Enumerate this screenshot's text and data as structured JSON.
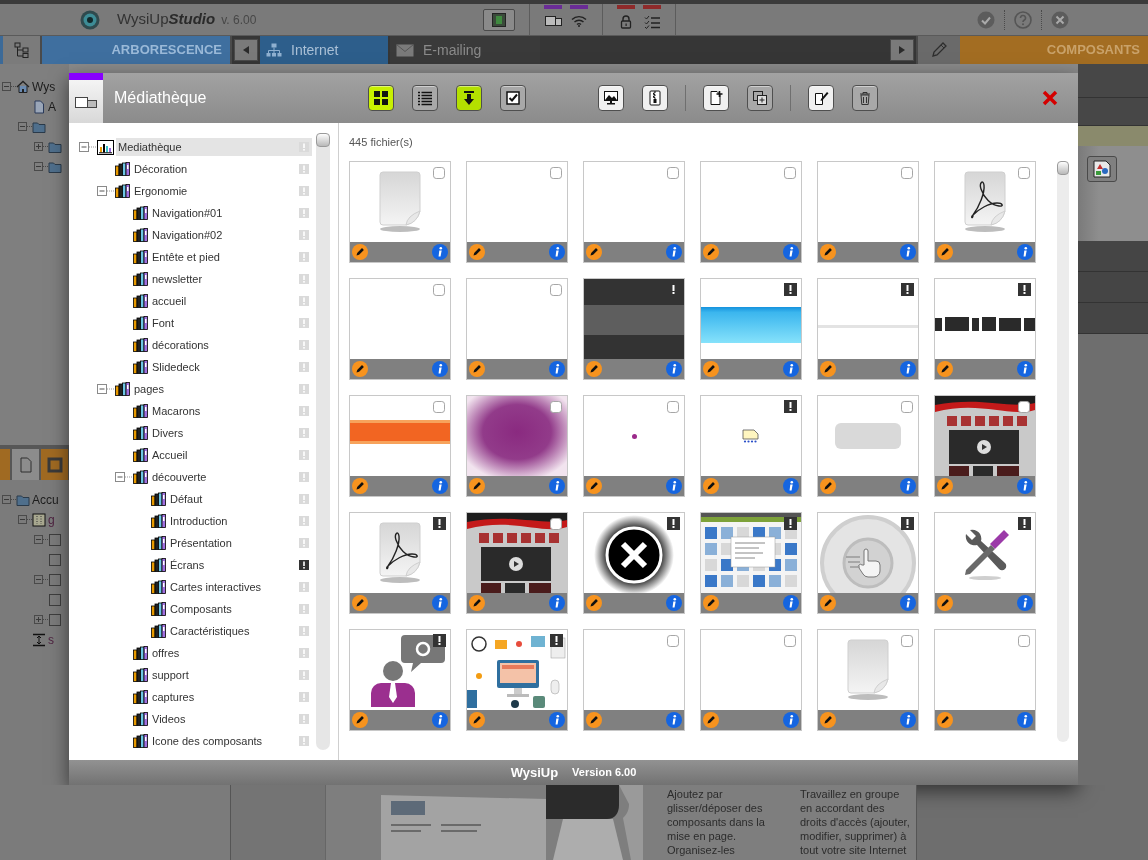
{
  "appbar": {
    "logo": "WysiUp",
    "logo_suffix": "Studio",
    "version": "v. 6.00",
    "tools": [
      {
        "kind": "frame"
      }
    ],
    "indicator_groups": [
      {
        "items": [
          {
            "kind": "windows",
            "color": "#6a2c96"
          },
          {
            "kind": "wifi",
            "color": "#6a2c96"
          }
        ]
      },
      {
        "items": [
          {
            "kind": "lock",
            "color": "#8e2a2a"
          },
          {
            "kind": "checklist",
            "color": "#8e2a2a"
          }
        ]
      }
    ],
    "actions": [
      {
        "kind": "confirm"
      },
      {
        "kind": "help"
      },
      {
        "kind": "close"
      }
    ]
  },
  "panels": {
    "left_title": "ARBORESCENCE",
    "tabs": [
      {
        "label": "Internet",
        "kind": "sitemap",
        "selected": true
      },
      {
        "label": "E-mailing",
        "kind": "mail",
        "selected": false
      }
    ],
    "right_title": "COMPOSANTS"
  },
  "site_tree": {
    "items": [
      {
        "kind": "home",
        "label": "Wys",
        "expanded": true,
        "children": [
          {
            "kind": "page",
            "label": "A"
          },
          {
            "kind": "folder",
            "expanded": true,
            "children": [
              {
                "kind": "folder",
                "expanded": false
              },
              {
                "kind": "folder",
                "expanded": true
              }
            ]
          }
        ]
      }
    ]
  },
  "side_tabs": [
    {
      "kind": "blank",
      "selected": false
    },
    {
      "kind": "page",
      "selected": true
    },
    {
      "kind": "frame",
      "selected": false
    }
  ],
  "layout_tree": {
    "items": [
      {
        "kind": "folder",
        "label": "Accu",
        "expanded": true,
        "children": [
          {
            "kind": "grid",
            "label": "g",
            "expanded": true,
            "children": [
              {
                "kind": "block",
                "expanded": true
              },
              {
                "kind": "block"
              },
              {
                "kind": "block",
                "expanded": true
              },
              {
                "kind": "block"
              },
              {
                "kind": "block",
                "expanded": false
              }
            ]
          },
          {
            "kind": "spacer",
            "label": "s"
          }
        ]
      }
    ]
  },
  "dialog": {
    "title": "Médiathèque",
    "toolbar": [
      {
        "divider_before": false,
        "buttons": [
          {
            "kind": "grid",
            "color": "#c8f000"
          },
          {
            "kind": "list",
            "color": "#a8a8a8"
          },
          {
            "kind": "download",
            "color": "#b4e000"
          },
          {
            "kind": "select",
            "color": "#a8a8a8"
          }
        ]
      },
      {
        "divider_before": false,
        "buttons": [
          {
            "kind": "image",
            "color": "#f0f0f0"
          },
          {
            "kind": "zip",
            "color": "#f0f0f0"
          }
        ]
      },
      {
        "divider_before": true,
        "buttons": [
          {
            "kind": "new",
            "color": "#f0f0f0"
          },
          {
            "kind": "duplicate",
            "color": "#a8a8a8"
          }
        ]
      },
      {
        "divider_before": true,
        "buttons": [
          {
            "kind": "edit",
            "color": "#f0f0f0"
          },
          {
            "kind": "delete",
            "color": "#a8a8a8"
          }
        ]
      }
    ],
    "library_tree": {
      "items": [
        {
          "label": "Mediathèque",
          "kind": "library",
          "selected": true,
          "flagged": false,
          "expanded": true,
          "children": [
            {
              "label": "Décoration",
              "kind": "shelf",
              "selected": false,
              "flagged": false
            },
            {
              "label": "Ergonomie",
              "kind": "shelf",
              "selected": false,
              "flagged": false,
              "expanded": true,
              "children": [
                {
                  "label": "Navigation#01",
                  "kind": "shelf",
                  "selected": false,
                  "flagged": false
                },
                {
                  "label": "Navigation#02",
                  "kind": "shelf",
                  "selected": false,
                  "flagged": false
                },
                {
                  "label": "Entête et pied",
                  "kind": "shelf",
                  "selected": false,
                  "flagged": false
                },
                {
                  "label": "newsletter",
                  "kind": "shelf",
                  "selected": false,
                  "flagged": false
                },
                {
                  "label": "accueil",
                  "kind": "shelf",
                  "selected": false,
                  "flagged": false
                },
                {
                  "label": "Font",
                  "kind": "shelf",
                  "selected": false,
                  "flagged": false
                },
                {
                  "label": "décorations",
                  "kind": "shelf",
                  "selected": false,
                  "flagged": false
                },
                {
                  "label": "Slidedeck",
                  "kind": "shelf",
                  "selected": false,
                  "flagged": false
                }
              ]
            },
            {
              "label": "pages",
              "kind": "shelf",
              "selected": false,
              "flagged": false,
              "expanded": true,
              "children": [
                {
                  "label": "Macarons",
                  "kind": "shelf",
                  "selected": false,
                  "flagged": false
                },
                {
                  "label": "Divers",
                  "kind": "shelf",
                  "selected": false,
                  "flagged": false
                },
                {
                  "label": "Accueil",
                  "kind": "shelf",
                  "selected": false,
                  "flagged": false
                },
                {
                  "label": "découverte",
                  "kind": "shelf",
                  "selected": false,
                  "flagged": false,
                  "expanded": true,
                  "children": [
                    {
                      "label": "Défaut",
                      "kind": "shelf",
                      "selected": false,
                      "flagged": false
                    },
                    {
                      "label": "Introduction",
                      "kind": "shelf",
                      "selected": false,
                      "flagged": false
                    },
                    {
                      "label": "Présentation",
                      "kind": "shelf",
                      "selected": false,
                      "flagged": false
                    },
                    {
                      "label": "Écrans",
                      "kind": "shelf",
                      "selected": false,
                      "flagged": true
                    },
                    {
                      "label": "Cartes interactives",
                      "kind": "shelf",
                      "selected": false,
                      "flagged": false
                    },
                    {
                      "label": "Composants",
                      "kind": "shelf",
                      "selected": false,
                      "flagged": false
                    },
                    {
                      "label": "Caractéristiques",
                      "kind": "shelf",
                      "selected": false,
                      "flagged": false
                    }
                  ]
                },
                {
                  "label": "offres",
                  "kind": "shelf",
                  "selected": false,
                  "flagged": false
                },
                {
                  "label": "support",
                  "kind": "shelf",
                  "selected": false,
                  "flagged": false
                },
                {
                  "label": "captures",
                  "kind": "shelf",
                  "selected": false,
                  "flagged": false
                },
                {
                  "label": "Videos",
                  "kind": "shelf",
                  "selected": false,
                  "flagged": false
                },
                {
                  "label": "Icone des composants",
                  "kind": "shelf",
                  "selected": false,
                  "flagged": false
                }
              ]
            }
          ]
        }
      ]
    },
    "file_count": "445 fichier(s)",
    "tiles": [
      {
        "kind": "page",
        "warning": false,
        "checked": false
      },
      {
        "kind": "blank",
        "warning": false,
        "checked": false
      },
      {
        "kind": "blank",
        "warning": false,
        "checked": false
      },
      {
        "kind": "blank",
        "warning": false,
        "checked": false
      },
      {
        "kind": "blank",
        "warning": false,
        "checked": false
      },
      {
        "kind": "pdf",
        "warning": false,
        "checked": false
      },
      {
        "kind": "blank",
        "warning": false,
        "checked": false
      },
      {
        "kind": "blank",
        "warning": false,
        "checked": false
      },
      {
        "kind": "dark-banner",
        "warning": true
      },
      {
        "kind": "blue-banner",
        "warning": true
      },
      {
        "kind": "line",
        "warning": true
      },
      {
        "kind": "text-banner",
        "warning": true
      },
      {
        "kind": "orange-banner",
        "warning": false,
        "checked": false
      },
      {
        "kind": "purple-blur",
        "warning": false,
        "checked": false
      },
      {
        "kind": "dot",
        "warning": false,
        "checked": false
      },
      {
        "kind": "note",
        "warning": true
      },
      {
        "kind": "pill",
        "warning": false,
        "checked": false
      },
      {
        "kind": "site-screenshot",
        "warning": false,
        "checked": false
      },
      {
        "kind": "pdf",
        "warning": true
      },
      {
        "kind": "site-screenshot",
        "warning": false,
        "checked": false
      },
      {
        "kind": "close-circle",
        "warning": true
      },
      {
        "kind": "app-screenshot",
        "warning": true
      },
      {
        "kind": "stamp",
        "warning": true
      },
      {
        "kind": "tools",
        "warning": true
      },
      {
        "kind": "person",
        "warning": true
      },
      {
        "kind": "illustration",
        "warning": true
      },
      {
        "kind": "blank",
        "warning": false,
        "checked": false
      },
      {
        "kind": "blank",
        "warning": false,
        "checked": false
      },
      {
        "kind": "page",
        "warning": false,
        "checked": false
      },
      {
        "kind": "blank",
        "warning": false,
        "checked": false
      }
    ],
    "footer": {
      "brand": "WysiUp",
      "version": "Version 6.00"
    }
  },
  "page_preview": {
    "columns": [
      {
        "lines": [
          "Ajoutez par",
          "glisser/déposer des",
          "composants dans la",
          "mise en page.",
          "Organisez-les"
        ]
      },
      {
        "lines": [
          "Travaillez en groupe",
          "en accordant des",
          "droits d'accès (ajouter,",
          "modifier, supprimer) à",
          "tout votre site Internet"
        ]
      }
    ]
  }
}
